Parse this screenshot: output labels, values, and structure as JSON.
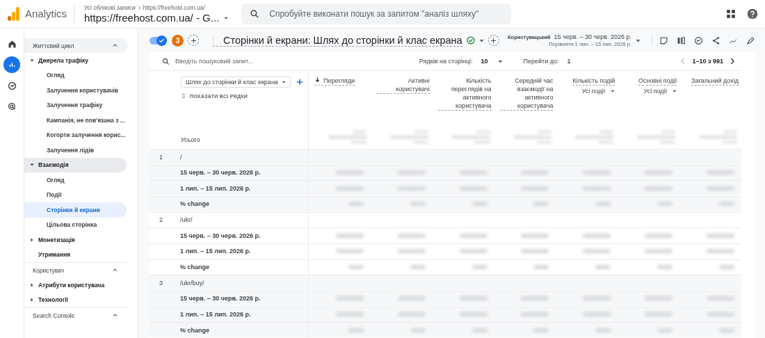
{
  "topbar": {
    "product": "Analytics",
    "breadcrumb_root": "Усі облікові записи",
    "breadcrumb_account": "https://freehost.com.ua/",
    "property": "https://freehost.com.ua/ - G...",
    "search_placeholder": "Спробуйте виконати пошук за запитом \"аналіз шляху\""
  },
  "rail": [
    {
      "selected": false
    },
    {
      "selected": true
    },
    {
      "selected": false
    },
    {
      "selected": false
    }
  ],
  "sidebar": [
    {
      "title": "Життєвий цикл",
      "expanded": true,
      "items": [
        {
          "kind": "group",
          "label": "Джерела трафіку",
          "expanded": true,
          "highlighted": false,
          "children": [
            {
              "label": "Огляд",
              "selected": false
            },
            {
              "label": "Залучення користувачів",
              "selected": false
            },
            {
              "label": "Залучення трафіку",
              "selected": false
            },
            {
              "label": "Кампанія, не пов'язана з ...",
              "selected": false
            },
            {
              "label": "Когорти залучення корис...",
              "selected": false
            },
            {
              "label": "Залучення лідів",
              "selected": false
            }
          ]
        },
        {
          "kind": "group",
          "label": "Взаємодія",
          "expanded": true,
          "highlighted": true,
          "children": [
            {
              "label": "Огляд",
              "selected": false
            },
            {
              "label": "Події",
              "selected": false
            },
            {
              "label": "Сторінки й екрани",
              "selected": true
            },
            {
              "label": "Цільова сторінка",
              "selected": false
            }
          ]
        },
        {
          "kind": "group",
          "label": "Монетизація",
          "expanded": false,
          "highlighted": false
        },
        {
          "kind": "link",
          "label": "Утримання"
        }
      ]
    },
    {
      "title": "Користувач",
      "expanded": true,
      "items": [
        {
          "kind": "group",
          "label": "Атрибути користувача",
          "expanded": false,
          "highlighted": false
        },
        {
          "kind": "group",
          "label": "Технології",
          "expanded": false,
          "highlighted": false
        }
      ]
    },
    {
      "title": "Search Console",
      "expanded": true
    }
  ],
  "report": {
    "compare_on": true,
    "comparison_count": "3",
    "title": "Сторінки й екрани: Шлях до сторінки й клас екрана",
    "date_label": "Користувацький",
    "date_range": "15 черв. – 30 черв. 2026 р.",
    "compare_range": "Порівняти:1 лип. – 15 лип. 2026 р."
  },
  "table": {
    "search_placeholder": "Введіть пошуковий запит...",
    "rows_label": "Рядків на сторінці:",
    "rows_value": "10",
    "goto_label": "Перейти до:",
    "goto_value": "1",
    "range": "1–10 з 991",
    "dimension": "Шлях до сторінки й клас екрана",
    "show_all": "ПОКАЗАТИ ВСІ РЯДКИ",
    "total_label": "Усього",
    "columns": [
      {
        "label": "Перегляди",
        "sorted": true
      },
      {
        "label": "Активні користувачі",
        "sorted": false
      },
      {
        "label": "Кількість переглядів на активного користувача",
        "sorted": false
      },
      {
        "label": "Середній час взаємодії на активного користувача",
        "sorted": false
      },
      {
        "label": "Кількість подій",
        "sorted": false,
        "filter": "Усі події"
      },
      {
        "label": "Основні події",
        "sorted": false,
        "filter": "Усі події"
      },
      {
        "label": "Загальний дохід",
        "sorted": false
      }
    ],
    "rows": [
      {
        "index": "1",
        "path": "/",
        "sub": [
          "15 черв. – 30 черв. 2026 р.",
          "1 лип. – 15 лип. 2026 р.",
          "% change"
        ]
      },
      {
        "index": "2",
        "path": "/ukr/",
        "sub": [
          "15 черв. – 30 черв. 2026 р.",
          "1 лип. – 15 лип. 2026 р.",
          "% change"
        ]
      },
      {
        "index": "3",
        "path": "/ukr/buy/",
        "sub": [
          "15 черв. – 30 черв. 2026 р.",
          "1 лип. – 15 лип. 2026 р.",
          "% change"
        ]
      }
    ]
  }
}
